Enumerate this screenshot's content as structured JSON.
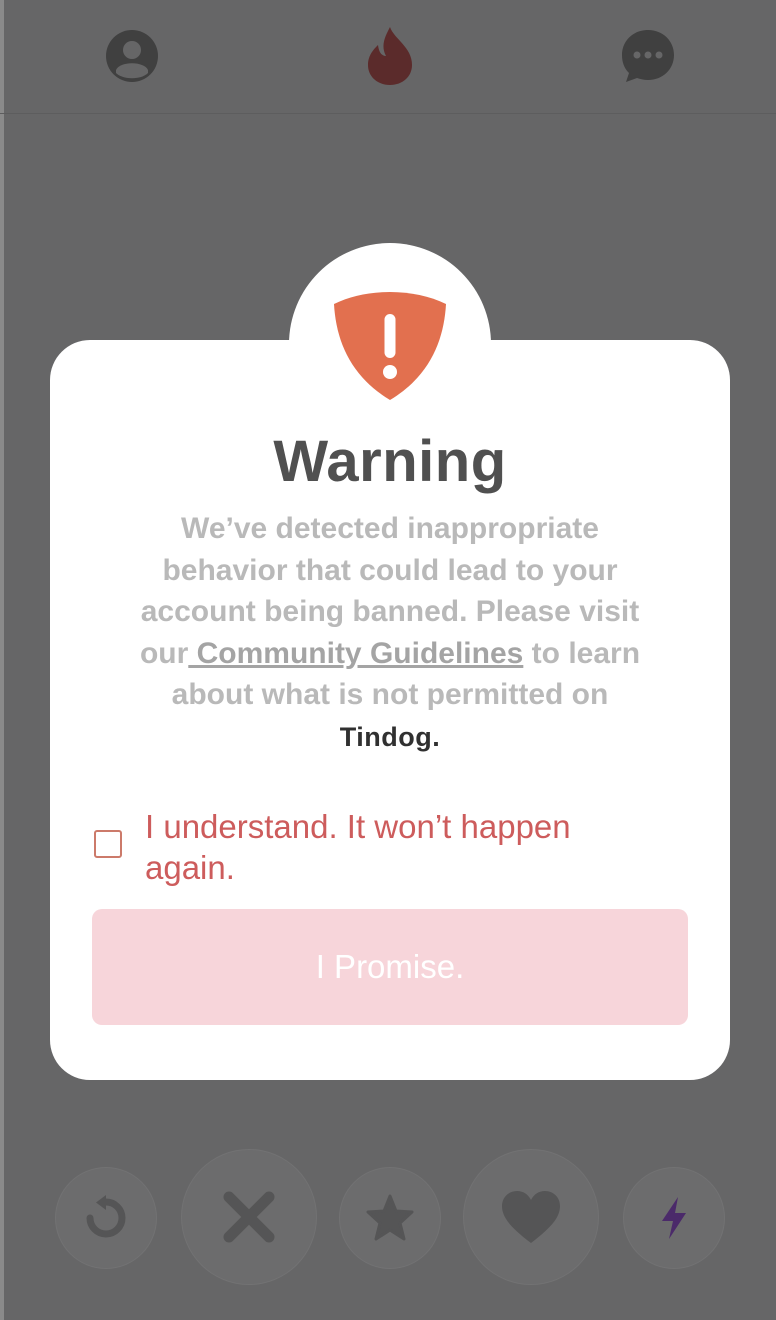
{
  "nav": {
    "profile_icon": "profile-icon",
    "home_icon": "flame-icon",
    "messages_icon": "chat-icon"
  },
  "dialog": {
    "title": "Warning",
    "message_part1": "We’ve detected inappropriate behavior that could lead to your account being banned. Please visit our",
    "link_text": " Community Guidelines",
    "message_part2": "to learn about what is not permitted on",
    "brand": "Tindog.",
    "checkbox_label": "I understand. It won’t happen again.",
    "checkbox_checked": false,
    "button_label": "I Promise.",
    "accent_color": "#e2704f"
  },
  "actions": {
    "rewind_icon": "rewind-icon",
    "nope_icon": "nope-x-icon",
    "super_like_icon": "star-icon",
    "like_icon": "heart-icon",
    "boost_icon": "lightning-icon"
  }
}
